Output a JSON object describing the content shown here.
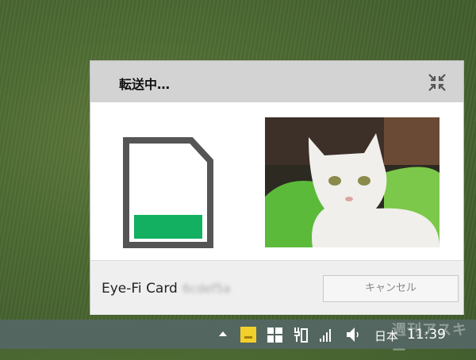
{
  "dialog": {
    "title": "転送中…",
    "card_label": "Eye-Fi Card",
    "card_id": "6cdef5a",
    "cancel_label": "キャンセル",
    "transfer_progress": 0.25,
    "accent_color": "#12b060",
    "icons": {
      "collapse": "collapse-arrows-icon",
      "card": "sd-card-icon"
    }
  },
  "taskbar": {
    "language": "日本",
    "time": "11:39",
    "icons": [
      "show-hidden-icons-chevron",
      "eye-fi-tray-icon",
      "windows-icon",
      "power-icon",
      "signal-icon",
      "volume-icon"
    ]
  },
  "watermark": "週刊アスキー"
}
